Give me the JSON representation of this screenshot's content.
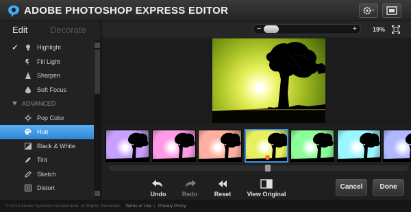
{
  "header": {
    "title": "ADOBE PHOTOSHOP EXPRESS EDITOR",
    "settings_icon": "gear-icon",
    "screen_icon": "fullscreen-icon"
  },
  "tabs": {
    "edit": "Edit",
    "decorate": "Decorate"
  },
  "menu": {
    "highlight": "Highlight",
    "fill_light": "Fill Light",
    "sharpen": "Sharpen",
    "soft_focus": "Soft Focus",
    "advanced": "ADVANCED",
    "pop_color": "Pop Color",
    "hue": "Hue",
    "black_white": "Black & White",
    "tint": "Tint",
    "sketch": "Sketch",
    "distort": "Distort",
    "check_mark": "✓",
    "active_item": "Hue",
    "active_color": "#3a93e0"
  },
  "zoom": {
    "minus": "−",
    "plus": "+",
    "level": "19%"
  },
  "filmstrip": {
    "selected_index": 3,
    "hues": [
      "#c9a0ff",
      "#ff9be6",
      "#ffb0a0",
      "#e8f060",
      "#8cff9a",
      "#9af6ff",
      "#b0b8ff"
    ]
  },
  "toolbar": {
    "undo": "Undo",
    "redo": "Redo",
    "reset": "Reset",
    "view_original": "View Original",
    "cancel": "Cancel",
    "done": "Done"
  },
  "footer": {
    "copyright": "© 2010 Adobe Systems Incorporated. All Rights Reserved.",
    "terms": "Terms of Use",
    "separator": "|",
    "privacy": "Privacy Policy"
  }
}
